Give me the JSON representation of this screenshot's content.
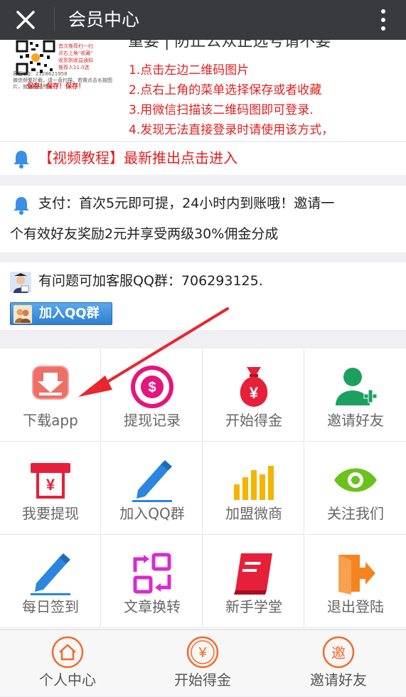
{
  "header": {
    "title": "会员中心"
  },
  "qr_card": {
    "tiny_lines": "首次推荐扫一扫\n点右上角\"收藏\"\n收到到收益通知\n推荐人11.0选",
    "service": "客服QQ：2128621958",
    "sub": "微信频繁拦截，请一直扫描，若需点击长按图片，就会推出所有",
    "save_text": "保存！保存！保存！",
    "cut_heading": "重要 | 防止公众正选号请不要",
    "steps": [
      "1.点击左边二维码图片",
      "2.点右上角的菜单选择保存或者收藏",
      "3.用微信扫描该二维码图即可登录.",
      "4.发现无法直接登录时请使用该方式，"
    ]
  },
  "notice_video": {
    "text": "【视频教程】最新推出点击进入"
  },
  "notice_pay": {
    "line1": "支付：首次5元即可提，24小时内到账哦！邀请一",
    "line2": "个有效好友奖励2元并享受两级30%佣金分成"
  },
  "qq_group": {
    "text": "有问题可加客服QQ群：706293125.",
    "button_label": "加入QQ群"
  },
  "grid": {
    "items": [
      {
        "label": "下载app",
        "icon": "download-icon"
      },
      {
        "label": "提现记录",
        "icon": "dollar-circle-icon"
      },
      {
        "label": "开始得金",
        "icon": "money-bag-icon"
      },
      {
        "label": "邀请好友",
        "icon": "add-user-icon"
      },
      {
        "label": "我要提现",
        "icon": "atm-icon"
      },
      {
        "label": "加入QQ群",
        "icon": "pencil-icon"
      },
      {
        "label": "加盟微商",
        "icon": "bar-chart-icon"
      },
      {
        "label": "关注我们",
        "icon": "eye-icon"
      },
      {
        "label": "每日签到",
        "icon": "pencil-icon"
      },
      {
        "label": "文章换转",
        "icon": "swap-icon"
      },
      {
        "label": "新手学堂",
        "icon": "book-icon"
      },
      {
        "label": "退出登陆",
        "icon": "logout-icon"
      }
    ]
  },
  "tabbar": {
    "tabs": [
      {
        "label": "个人中心",
        "icon": "home-icon"
      },
      {
        "label": "开始得金",
        "icon": "yen-icon",
        "glyph": "¥"
      },
      {
        "label": "邀请好友",
        "icon": "invite-icon",
        "glyph": "邀"
      }
    ]
  },
  "colors": {
    "header_bg": "#393a3e",
    "accent_red": "#e02020",
    "tab_orange": "#f36b2a",
    "bell_blue": "#3a8ee6"
  }
}
